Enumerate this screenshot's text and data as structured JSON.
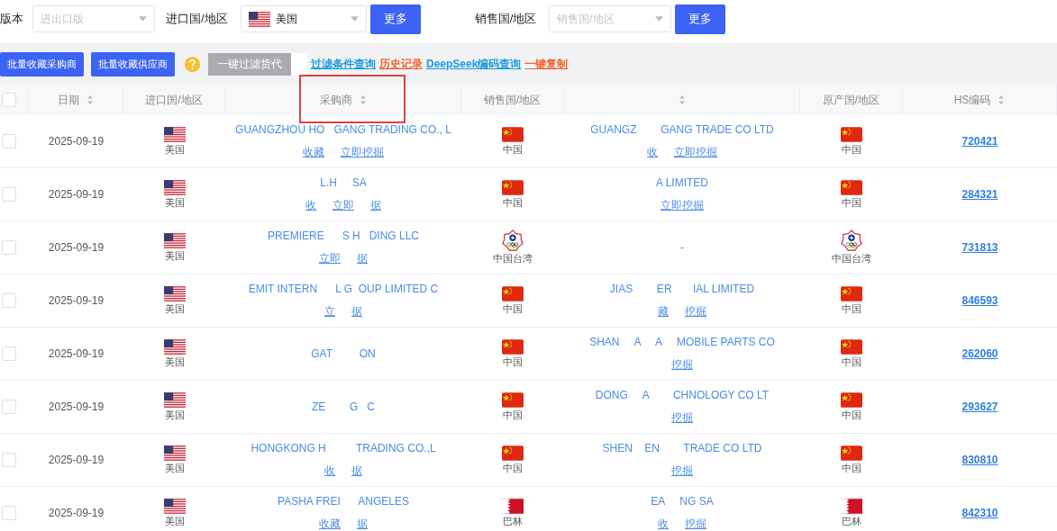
{
  "filters": [
    {
      "label": "版本",
      "placeholder": "进出口版"
    },
    {
      "label": "进口国/地区",
      "value": "美国",
      "kind": "us",
      "button": "更多"
    },
    {
      "label": "销售国/地区",
      "placeholder": "销售国/地区",
      "button": "更多"
    }
  ],
  "toolbar": {
    "buttons": [
      "批量收藏采购商",
      "批量收藏供应商"
    ],
    "filter_button": {
      "label": "一键过滤货代",
      "disabled": true
    },
    "links": [
      {
        "label": "过滤条件查询",
        "color": "#1a9be0"
      },
      {
        "label": "历史记录",
        "color": "#f0642d"
      },
      {
        "label": "DeepSeek编码查询",
        "color": "#1a9be0"
      },
      {
        "label": "一键复制",
        "color": "#f0642d"
      }
    ]
  },
  "table": {
    "select_all_checked": false,
    "columns": [
      {
        "label": "日期",
        "sortable": true,
        "highlighted": false
      },
      {
        "label": "进口国/地区",
        "sortable": false,
        "highlighted": false
      },
      {
        "label": "采购商",
        "sortable": true,
        "highlighted": true
      },
      {
        "label": "销售国/地区",
        "sortable": false,
        "highlighted": false
      },
      {
        "sortable": true,
        "highlighted": false
      },
      {
        "label": "原产国/地区",
        "sortable": false,
        "highlighted": false
      },
      {
        "label": "HS编码",
        "sortable": true,
        "highlighted": false
      }
    ],
    "rows": [
      {
        "checked": false,
        "date": "2025-09-19",
        "importer": {
          "kind": "us",
          "name": "美国"
        },
        "buyer": "GUANGZHOU HO   GANG TRADING CO., L",
        "buyer_links": [
          "收藏",
          "立即挖掘"
        ],
        "seller_country": {
          "kind": "cn",
          "name": "中国"
        },
        "supplier": "GUANGZ        GANG TRADE CO LTD",
        "supplier_links": [
          "收",
          "立即挖掘"
        ],
        "origin": {
          "kind": "cn",
          "name": "中国"
        },
        "hs": "720421"
      },
      {
        "checked": false,
        "date": "2025-09-19",
        "importer": {
          "kind": "us",
          "name": "美国"
        },
        "buyer": "L.H     SA",
        "buyer_links": [
          "收",
          "立即",
          "据"
        ],
        "seller_country": {
          "kind": "cn",
          "name": "中国"
        },
        "supplier": "A LIMITED",
        "supplier_links": [
          "立即挖掘"
        ],
        "origin": {
          "kind": "cn",
          "name": "中国"
        },
        "hs": "284321"
      },
      {
        "checked": false,
        "date": "2025-09-19",
        "importer": {
          "kind": "us",
          "name": "美国"
        },
        "buyer": "PREMIERE      S H   DING LLC",
        "buyer_links": [
          "立即",
          "据"
        ],
        "seller_country": {
          "kind": "tpe",
          "name": "中国台湾"
        },
        "supplier": "-",
        "supplier_links": [],
        "origin": {
          "kind": "tpe",
          "name": "中国台湾"
        },
        "hs": "731813"
      },
      {
        "checked": false,
        "date": "2025-09-19",
        "importer": {
          "kind": "us",
          "name": "美国"
        },
        "buyer": "EMIT INTERN      L G  OUP LIMITED C",
        "buyer_links": [
          "立",
          "据"
        ],
        "seller_country": {
          "kind": "cn",
          "name": "中国"
        },
        "supplier": "JIAS        ER       IAL LIMITED",
        "supplier_links": [
          "藏",
          "挖掘"
        ],
        "origin": {
          "kind": "cn",
          "name": "中国"
        },
        "hs": "846593"
      },
      {
        "checked": false,
        "date": "2025-09-19",
        "importer": {
          "kind": "us",
          "name": "美国"
        },
        "buyer": "GAT         ON",
        "buyer_links": [],
        "seller_country": {
          "kind": "cn",
          "name": "中国"
        },
        "supplier": "SHAN     A     A     MOBILE PARTS CO",
        "supplier_links": [
          "挖掘"
        ],
        "origin": {
          "kind": "cn",
          "name": "中国"
        },
        "hs": "262060"
      },
      {
        "checked": false,
        "date": "2025-09-19",
        "importer": {
          "kind": "us",
          "name": "美国"
        },
        "buyer": "ZE        G   C",
        "buyer_links": [],
        "seller_country": {
          "kind": "cn",
          "name": "中国"
        },
        "supplier": "DONG     A        CHNOLOGY CO LT",
        "supplier_links": [
          "挖掘"
        ],
        "origin": {
          "kind": "cn",
          "name": "中国"
        },
        "hs": "293627"
      },
      {
        "checked": false,
        "date": "2025-09-19",
        "importer": {
          "kind": "us",
          "name": "美国"
        },
        "buyer": "HONGKONG H          TRADING CO.,L",
        "buyer_links": [
          "收",
          "据"
        ],
        "seller_country": {
          "kind": "cn",
          "name": "中国"
        },
        "supplier": "SHEN    EN        TRADE CO LTD",
        "supplier_links": [
          "挖掘"
        ],
        "origin": {
          "kind": "cn",
          "name": "中国"
        },
        "hs": "830810"
      },
      {
        "checked": false,
        "date": "2025-09-19",
        "importer": {
          "kind": "us",
          "name": "美国"
        },
        "buyer": "PASHA FREI      ANGELES",
        "buyer_links": [
          "收藏",
          "据"
        ],
        "seller_country": {
          "kind": "bh",
          "name": "巴林"
        },
        "supplier": "EA     NG SA",
        "supplier_links": [
          "收",
          "挖掘"
        ],
        "origin": {
          "kind": "bh",
          "name": "巴林"
        },
        "hs": "842310"
      }
    ]
  }
}
